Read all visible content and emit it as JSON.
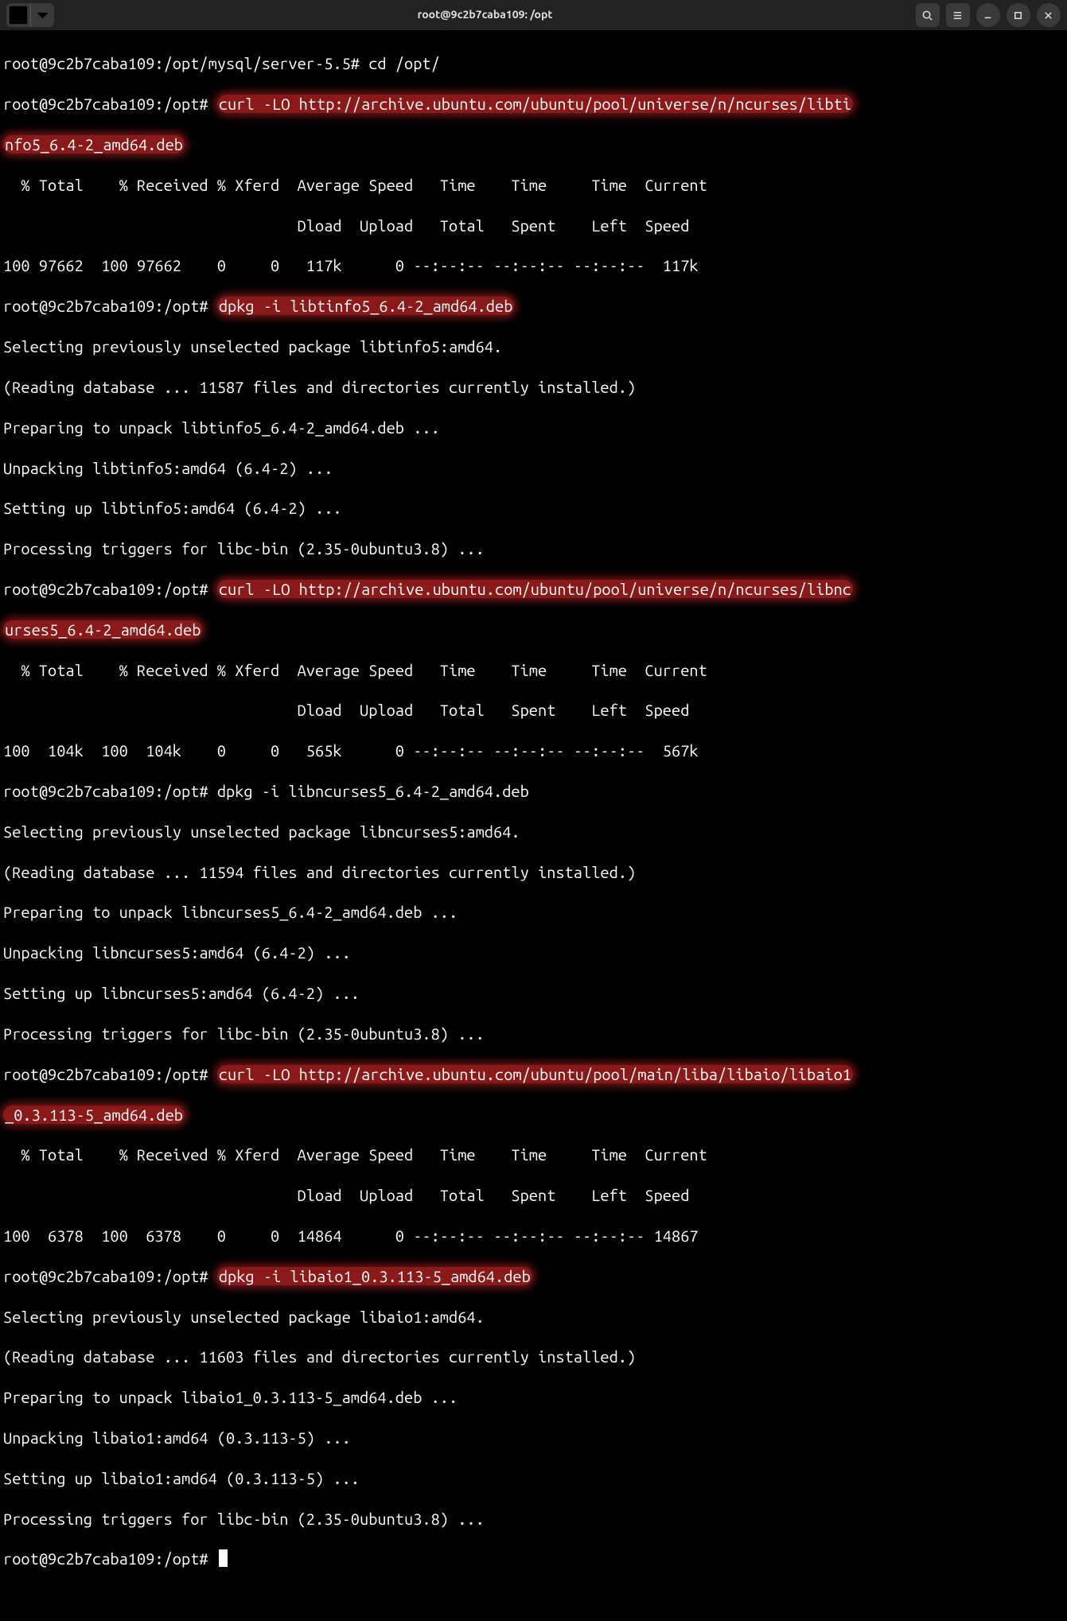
{
  "window": {
    "title": "root@9c2b7caba109: /opt"
  },
  "prompts": {
    "p_server55": "root@9c2b7caba109:/opt/mysql/server-5.5# ",
    "p_opt": "root@9c2b7caba109:/opt# "
  },
  "commands": {
    "cd_opt": "cd /opt/",
    "curl_libtinfo": "curl -LO http://archive.ubuntu.com/ubuntu/pool/universe/n/ncurses/libti",
    "curl_libtinfo_wrap": "nfo5_6.4-2_amd64.deb",
    "dpkg_libtinfo": "dpkg -i libtinfo5_6.4-2_amd64.deb",
    "curl_libncurses": "curl -LO http://archive.ubuntu.com/ubuntu/pool/universe/n/ncurses/libnc",
    "curl_libncurses_wrap": "urses5_6.4-2_amd64.deb",
    "dpkg_libncurses": "dpkg -i libncurses5_6.4-2_amd64.deb",
    "curl_libaio": "curl -LO http://archive.ubuntu.com/ubuntu/pool/main/liba/libaio/libaio1",
    "curl_libaio_wrap": "_0.3.113-5_amd64.deb",
    "dpkg_libaio": "dpkg -i libaio1_0.3.113-5_amd64.deb"
  },
  "curl_header1": "  % Total    % Received % Xferd  Average Speed   Time    Time     Time  Current",
  "curl_header2": "                                 Dload  Upload   Total   Spent    Left  Speed",
  "curl_lines": {
    "libtinfo": "100 97662  100 97662    0     0   117k      0 --:--:-- --:--:-- --:--:--  117k",
    "libncurses": "100  104k  100  104k    0     0   565k      0 --:--:-- --:--:-- --:--:--  567k",
    "libaio": "100  6378  100  6378    0     0  14864      0 --:--:-- --:--:-- --:--:-- 14867"
  },
  "dpkg_out": {
    "libtinfo": [
      "Selecting previously unselected package libtinfo5:amd64.",
      "(Reading database ... 11587 files and directories currently installed.)",
      "Preparing to unpack libtinfo5_6.4-2_amd64.deb ...",
      "Unpacking libtinfo5:amd64 (6.4-2) ...",
      "Setting up libtinfo5:amd64 (6.4-2) ...",
      "Processing triggers for libc-bin (2.35-0ubuntu3.8) ..."
    ],
    "libncurses": [
      "Selecting previously unselected package libncurses5:amd64.",
      "(Reading database ... 11594 files and directories currently installed.)",
      "Preparing to unpack libncurses5_6.4-2_amd64.deb ...",
      "Unpacking libncurses5:amd64 (6.4-2) ...",
      "Setting up libncurses5:amd64 (6.4-2) ...",
      "Processing triggers for libc-bin (2.35-0ubuntu3.8) ..."
    ],
    "libaio": [
      "Selecting previously unselected package libaio1:amd64.",
      "(Reading database ... 11603 files and directories currently installed.)",
      "Preparing to unpack libaio1_0.3.113-5_amd64.deb ...",
      "Unpacking libaio1:amd64 (0.3.113-5) ...",
      "Setting up libaio1:amd64 (0.3.113-5) ...",
      "Processing triggers for libc-bin (2.35-0ubuntu3.8) ..."
    ]
  }
}
